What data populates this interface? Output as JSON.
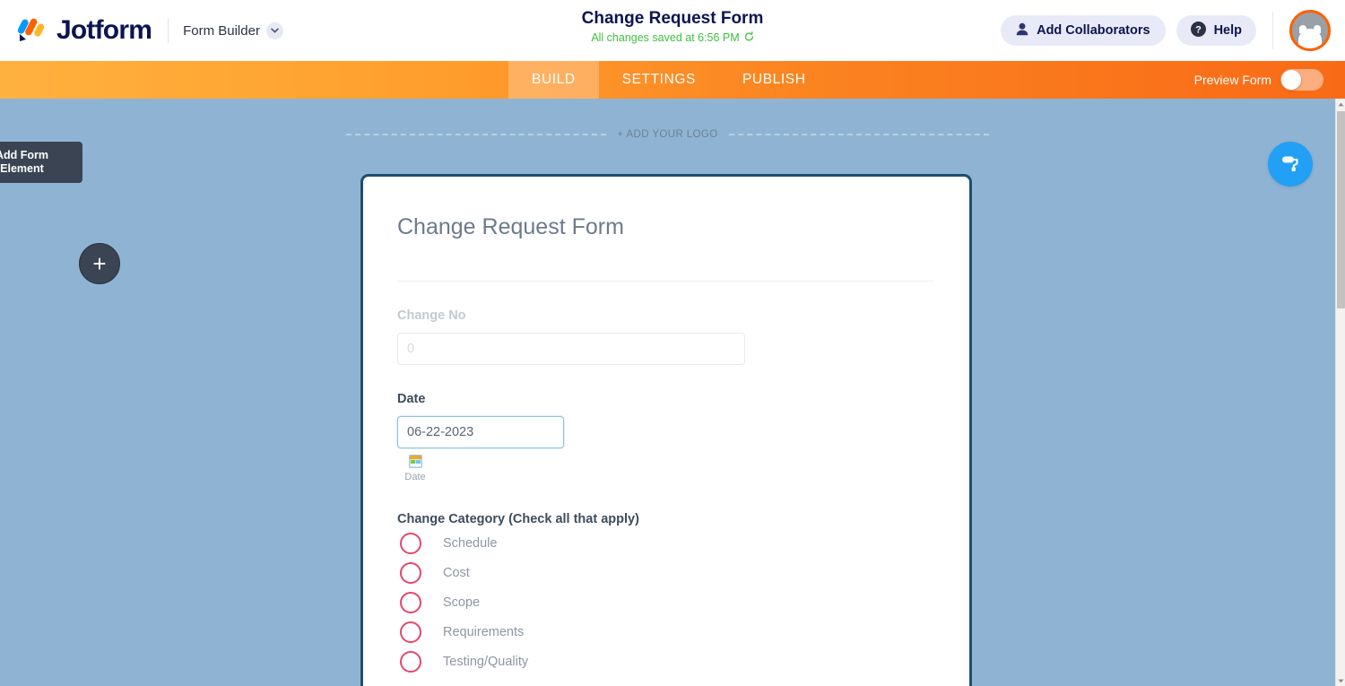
{
  "header": {
    "logo_text": "Jotform",
    "logo_icon": "jotform-logo-icon",
    "product_menu": "Form Builder",
    "chevron_icon": "chevron-down-icon",
    "form_title": "Change Request Form",
    "save_status": "All changes saved at 6:56 PM",
    "undo_icon": "undo-icon",
    "add_collaborators": "Add Collaborators",
    "collaborator_icon": "person-icon",
    "help": "Help",
    "help_icon": "question-circle-icon",
    "avatar_icon": "user-avatar"
  },
  "nav": {
    "tabs": [
      {
        "label": "BUILD",
        "active": true
      },
      {
        "label": "SETTINGS",
        "active": false
      },
      {
        "label": "PUBLISH",
        "active": false
      }
    ],
    "preview_label": "Preview Form",
    "preview_toggle_state": "off"
  },
  "canvas": {
    "add_element_label": "Add Form\nElement",
    "add_element_plus": "+",
    "designer_icon": "paint-roller-icon",
    "add_logo_label": "+ ADD YOUR LOGO"
  },
  "form": {
    "heading": "Change Request Form",
    "fields": [
      {
        "label": "Change No",
        "placeholder": "0",
        "value": "",
        "faded": true
      },
      {
        "label": "Date",
        "value": "06-22-2023",
        "sub_label": "Date",
        "sub_icon": "calendar-icon",
        "focused": true
      }
    ],
    "check_group": {
      "heading": "Change Category (Check all that apply)",
      "options": [
        "Schedule",
        "Cost",
        "Scope",
        "Requirements",
        "Testing/Quality"
      ]
    }
  },
  "scrollbar": {
    "up_icon": "scroll-up-arrow-icon",
    "down_icon": "scroll-down-arrow-icon",
    "thumb": "scroll-thumb"
  },
  "colors": {
    "brand_navy": "#0a1551",
    "orange_left": "#ffb13f",
    "orange_right": "#f96a16",
    "canvas_blue": "#8fb4d3",
    "card_border": "#1d4e6e",
    "checkbox_pink": "#e5466b",
    "saved_green": "#3ec13e",
    "designer_blue": "#21a0f6"
  }
}
